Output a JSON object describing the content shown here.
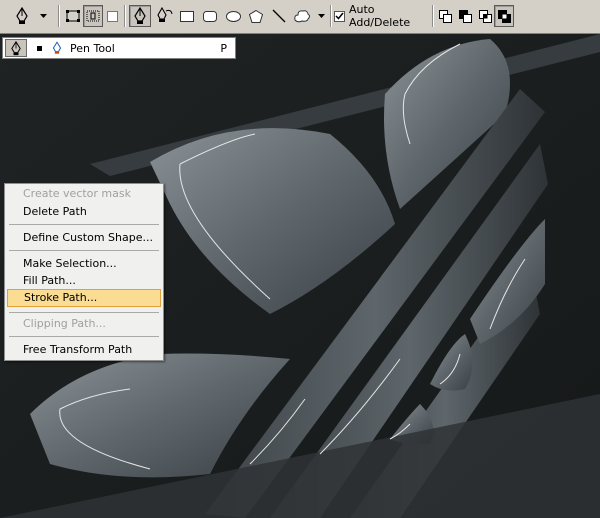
{
  "toolbar": {
    "tool_icon": "pen-tool-icon",
    "auto_add_delete": {
      "label": "Auto Add/Delete",
      "checked": true
    },
    "shapes": [
      "rectangle-icon",
      "rounded-rectangle-icon",
      "ellipse-icon",
      "polygon-icon",
      "line-icon",
      "custom-shape-icon"
    ],
    "path_ops": [
      "add-to-path-icon",
      "subtract-path-icon",
      "intersect-path-icon",
      "exclude-path-icon"
    ]
  },
  "preset": {
    "label": "Pen Tool",
    "key": "P"
  },
  "menu": {
    "items": [
      {
        "label": "Create vector mask",
        "disabled": true
      },
      {
        "label": "Delete Path"
      },
      {
        "label": "Define Custom Shape..."
      },
      {
        "label": "Make Selection..."
      },
      {
        "label": "Fill Path..."
      },
      {
        "label": "Stroke Path...",
        "highlighted": true
      },
      {
        "label": "Clipping Path...",
        "disabled": true
      },
      {
        "label": "Free Transform Path"
      }
    ]
  },
  "colors": {
    "highlight": "#fadc93",
    "highlight_border": "#e0a33c",
    "toolbar_bg": "#d4d0c8",
    "canvas_bg": "#1b1e1e"
  }
}
